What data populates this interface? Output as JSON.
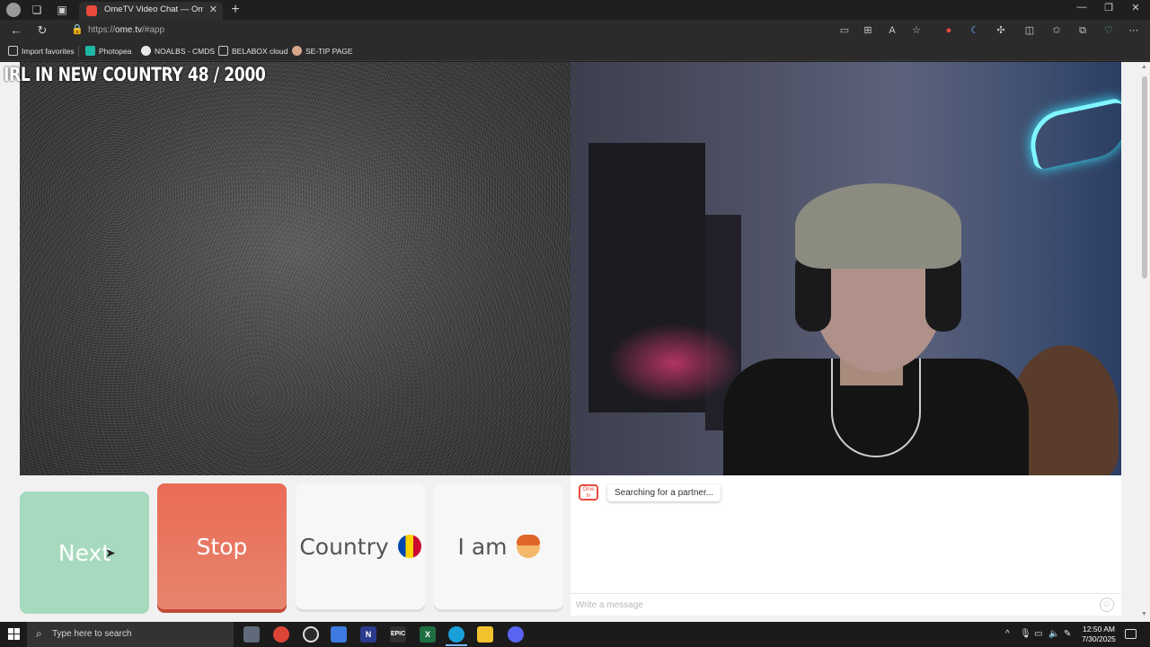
{
  "browser": {
    "tab_title": "OmeTV Video Chat — Ome",
    "tab_close": "✕",
    "new_tab": "+",
    "url_prefix": "https://",
    "url_host": "ome.tv",
    "url_rest": "/#app",
    "window_controls": [
      "—",
      "❐",
      "✕"
    ]
  },
  "favorites": [
    {
      "label": "Import favorites",
      "icon": "import-icon"
    },
    {
      "label": "Photopea",
      "icon": "photopea-icon"
    },
    {
      "label": "NOALBS - CMDS",
      "icon": "github-icon"
    },
    {
      "label": "BELABOX cloud",
      "icon": "page-icon"
    },
    {
      "label": "SE-TIP PAGE",
      "icon": "streamelements-icon"
    }
  ],
  "overlay": {
    "title": "IRL IN NEW COUNTRY  48 / 2000"
  },
  "buttons": {
    "next": "Next",
    "stop": "Stop",
    "country": "Country",
    "iam": "I am"
  },
  "chat": {
    "logo_text": "Ome tv",
    "status": "Searching for a partner...",
    "input_placeholder": "Write a message",
    "input_value": ""
  },
  "taskbar": {
    "search_placeholder": "Type here to search",
    "time": "12:50 AM",
    "date": "7/30/2025"
  },
  "colors": {
    "next_button": "#a6d9bd",
    "stop_button": "#ea6b55",
    "brand_red": "#e94b3c"
  }
}
